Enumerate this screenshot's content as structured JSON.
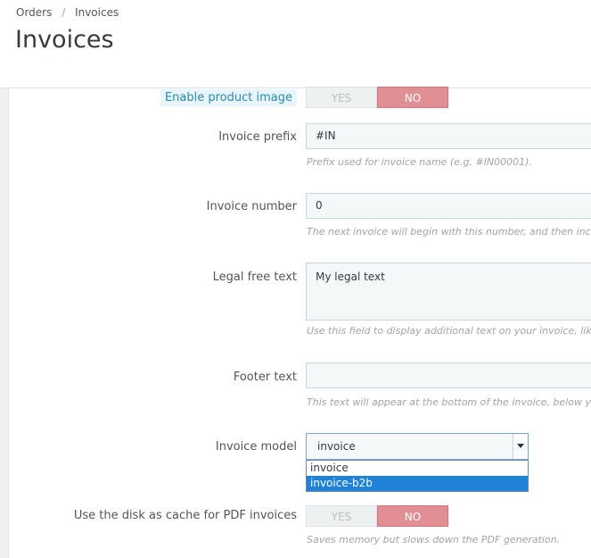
{
  "breadcrumb": {
    "items": [
      "Orders",
      "Invoices"
    ],
    "separator": "/"
  },
  "page": {
    "title": "Invoices"
  },
  "form": {
    "enable_product_image": {
      "label": "Enable product image",
      "yes": "YES",
      "no": "NO",
      "value": "NO"
    },
    "invoice_prefix": {
      "label": "Invoice prefix",
      "value": "#IN",
      "help": "Prefix used for invoice name (e.g. #IN00001)."
    },
    "invoice_number": {
      "label": "Invoice number",
      "value": "0",
      "help": "The next invoice will begin with this number, and then incr"
    },
    "legal_free_text": {
      "label": "Legal free text",
      "value": "My legal text",
      "help": "Use this field to display additional text on your invoice, like"
    },
    "footer_text": {
      "label": "Footer text",
      "value": "",
      "help": "This text will appear at the bottom of the invoice, below you"
    },
    "invoice_model": {
      "label": "Invoice model",
      "value": "invoice",
      "options": [
        "invoice",
        "invoice-b2b"
      ],
      "highlighted_option": "invoice-b2b"
    },
    "disk_cache": {
      "label": "Use the disk as cache for PDF invoices",
      "yes": "YES",
      "no": "NO",
      "value": "NO",
      "help": "Saves memory but slows down the PDF generation."
    }
  },
  "colors": {
    "no_active": "#e08f95",
    "dropdown_highlight": "#1e82d6",
    "label_highlight_bg": "#e8f5fa"
  }
}
